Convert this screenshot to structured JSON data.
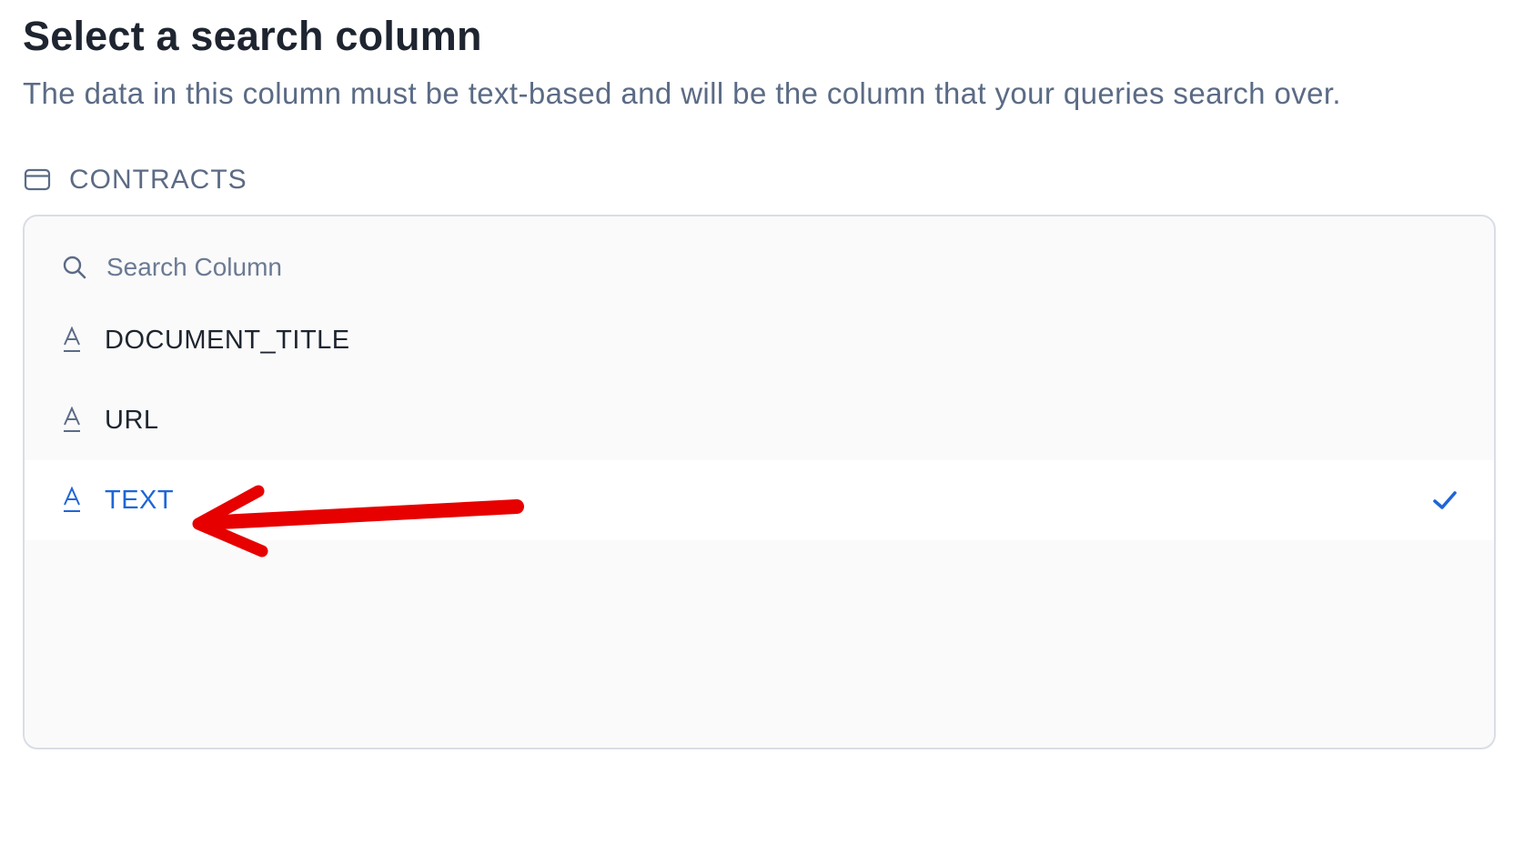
{
  "header": {
    "title": "Select a search column",
    "subtitle": "The data in this column must be text-based and will be the column that your queries search over."
  },
  "table": {
    "icon": "table-icon",
    "name": "CONTRACTS"
  },
  "search": {
    "icon": "search-icon",
    "placeholder": "Search Column",
    "value": ""
  },
  "columns": [
    {
      "label": "DOCUMENT_TITLE",
      "type_icon": "text-type-icon",
      "selected": false
    },
    {
      "label": "URL",
      "type_icon": "text-type-icon",
      "selected": false
    },
    {
      "label": "TEXT",
      "type_icon": "text-type-icon",
      "selected": true
    }
  ],
  "annotation": {
    "icon": "red-arrow-icon",
    "points_to": "TEXT"
  },
  "colors": {
    "title": "#1e2530",
    "muted": "#5b6b85",
    "selected": "#1f66d6",
    "panel_bg": "#fafafa",
    "panel_border": "#d9dde6",
    "arrow": "#e60000"
  }
}
